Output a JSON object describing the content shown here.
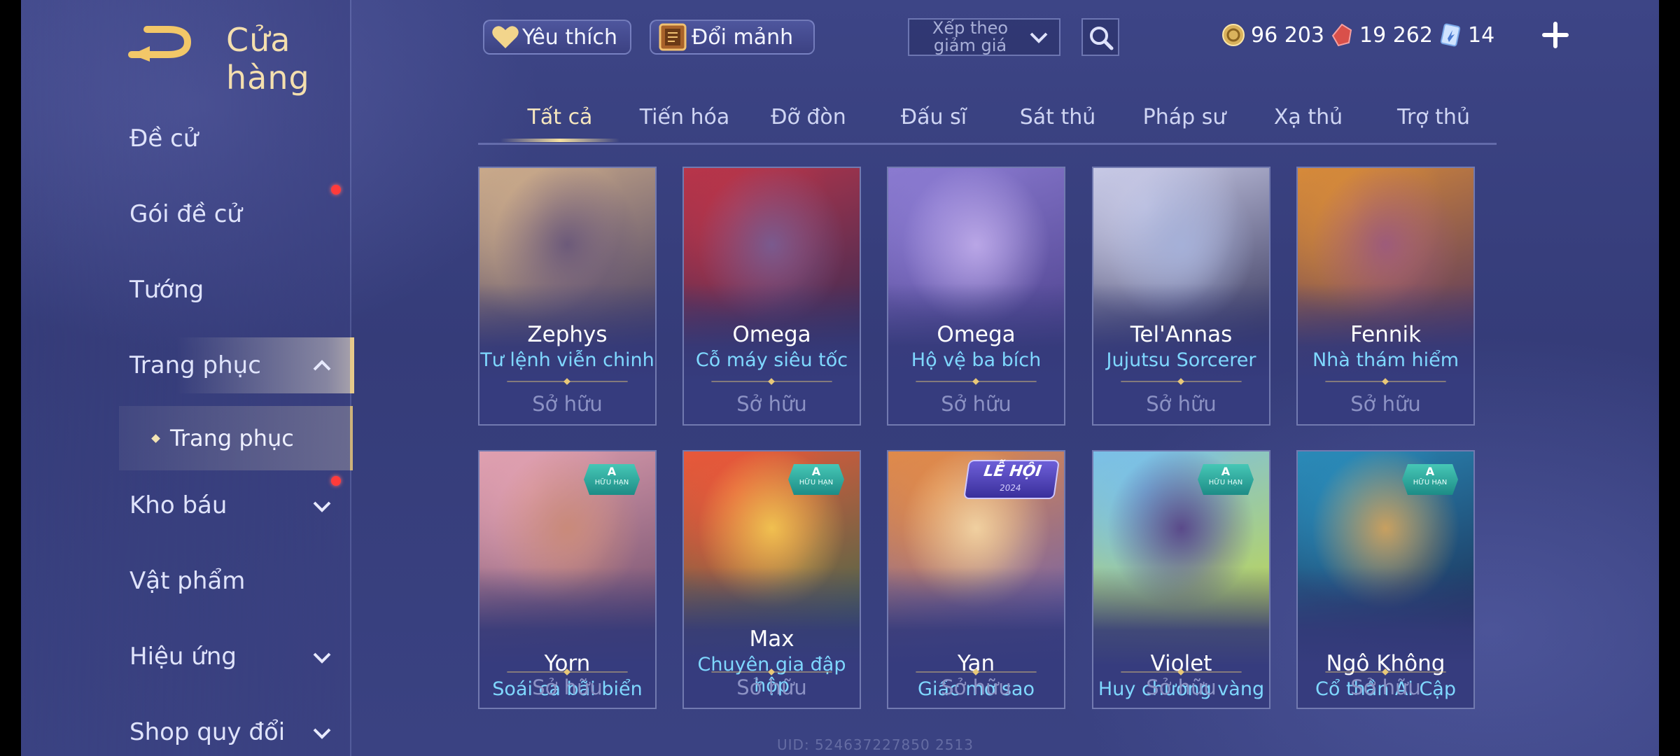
{
  "header": {
    "title": "Cửa hàng",
    "favorites_label": "Yêu thích",
    "exchange_label": "Đổi mảnh",
    "sort_label": "Xếp theo giảm giá",
    "currencies": [
      {
        "icon": "gold-coin-icon",
        "value": "96 203"
      },
      {
        "icon": "red-gem-icon",
        "value": "19 262"
      },
      {
        "icon": "voucher-card-icon",
        "value": "14"
      }
    ]
  },
  "sidebar": {
    "items": [
      {
        "label": "Đề cử",
        "has_dot": false,
        "chevron": ""
      },
      {
        "label": "Gói đề cử",
        "has_dot": true,
        "chevron": ""
      },
      {
        "label": "Tướng",
        "has_dot": false,
        "chevron": ""
      },
      {
        "label": "Trang phục",
        "has_dot": false,
        "chevron": "up",
        "active": true
      },
      {
        "label": "Kho báu",
        "has_dot": true,
        "chevron": "down"
      },
      {
        "label": "Vật phẩm",
        "has_dot": false,
        "chevron": ""
      },
      {
        "label": "Hiệu ứng",
        "has_dot": false,
        "chevron": "down"
      },
      {
        "label": "Shop quy đổi",
        "has_dot": false,
        "chevron": "down"
      }
    ],
    "sub_item": "Trang phục"
  },
  "tabs": [
    "Tất cả",
    "Tiến hóa",
    "Đỡ đòn",
    "Đấu sĩ",
    "Sát thủ",
    "Pháp sư",
    "Xạ thủ",
    "Trợ thủ"
  ],
  "active_tab": 0,
  "cards": [
    {
      "hero": "Zephys",
      "skin": "Tư lệnh viễn chinh",
      "status": "Sở hữu",
      "badge": "",
      "colors": [
        "#c9a98a",
        "#3b3560",
        "#6c5a7a"
      ]
    },
    {
      "hero": "Omega",
      "skin": "Cỗ máy siêu tốc",
      "status": "Sở hữu",
      "badge": "",
      "colors": [
        "#b8354a",
        "#2f2a55",
        "#7a5a8e"
      ]
    },
    {
      "hero": "Omega",
      "skin": "Hộ vệ ba bích",
      "status": "Sở hữu",
      "badge": "",
      "colors": [
        "#8a7ad0",
        "#4a3f8a",
        "#b9a6e6"
      ]
    },
    {
      "hero": "Tel'Annas",
      "skin": "Jujutsu Sorcerer",
      "status": "Sở hữu",
      "badge": "",
      "colors": [
        "#c7c9e6",
        "#2c2b50",
        "#a5b0d8"
      ]
    },
    {
      "hero": "Fennik",
      "skin": "Nhà thám hiểm",
      "status": "Sở hữu",
      "badge": "",
      "colors": [
        "#d68a3a",
        "#4b2f60",
        "#9d5b7a"
      ]
    },
    {
      "hero": "Yorn",
      "skin": "Soái ca bãi biển",
      "status": "Sở hữu",
      "badge": "A",
      "badge_sub": "HỮU HẠN",
      "colors": [
        "#e0a0b0",
        "#6b4a6a",
        "#c98a7a"
      ]
    },
    {
      "hero": "Max",
      "skin": "Chuyên gia đập hộp",
      "status": "Sở hữu",
      "badge": "A",
      "badge_sub": "HỮU HẠN",
      "colors": [
        "#e8583a",
        "#3a6a4a",
        "#f0c050"
      ]
    },
    {
      "hero": "Yan",
      "skin": "Giấc mơ sao",
      "status": "Sở hữu",
      "badge": "LỄ HỘI",
      "badge_sub": "2024",
      "colors": [
        "#e08a4a",
        "#6a5fb0",
        "#f0d0a0"
      ]
    },
    {
      "hero": "Violet",
      "skin": "Huy chương vàng",
      "status": "Sở hữu",
      "badge": "A",
      "badge_sub": "HỮU HẠN",
      "colors": [
        "#7ac0e8",
        "#c8d840",
        "#5a4a8a"
      ]
    },
    {
      "hero": "Ngô Không",
      "skin": "Cổ thần Ai Cập",
      "status": "Sở hữu",
      "badge": "A",
      "badge_sub": "HỮU HẠN",
      "colors": [
        "#2a8ab8",
        "#1a2a50",
        "#c8a060"
      ]
    }
  ],
  "uid_text": "UID: 524637227850 2513"
}
